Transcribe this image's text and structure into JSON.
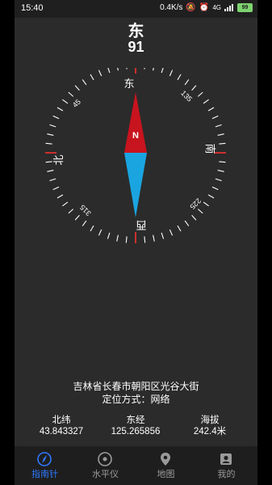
{
  "status": {
    "time": "15:40",
    "speed": "0.4K/s",
    "network": "4G",
    "battery": "99"
  },
  "compass": {
    "direction_label": "东",
    "heading_degrees": "91",
    "needle_label": "N",
    "cardinals": {
      "east": "东",
      "south": "南",
      "west": "西",
      "north": "北"
    },
    "degree_marks": {
      "d45": "45",
      "d135": "135",
      "d225": "225",
      "d315": "315"
    }
  },
  "location": {
    "address": "吉林省长春市朝阳区光谷大街",
    "method": "定位方式：网络"
  },
  "coordinates": {
    "latitude_label": "北纬",
    "latitude_value": "43.843327",
    "longitude_label": "东经",
    "longitude_value": "125.265856",
    "altitude_label": "海拔",
    "altitude_value": "242.4米"
  },
  "tabs": [
    {
      "label": "指南针",
      "icon": "compass-icon",
      "active": true
    },
    {
      "label": "水平仪",
      "icon": "level-icon",
      "active": false
    },
    {
      "label": "地图",
      "icon": "map-pin-icon",
      "active": false
    },
    {
      "label": "我的",
      "icon": "profile-icon",
      "active": false
    }
  ],
  "colors": {
    "accent": "#2f78ff",
    "needle_north": "#c8141e",
    "needle_south": "#1aa5e0",
    "red_tick": "#e03030"
  }
}
